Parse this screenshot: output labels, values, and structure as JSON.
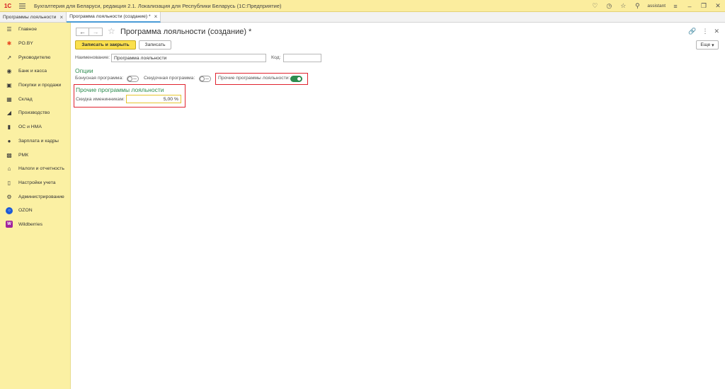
{
  "titlebar": {
    "logo": "1С",
    "title": "Бухгалтерия для Беларуси, редакция 2.1. Локализация для Республики Беларусь   (1С:Предприятие)",
    "user": "assistant"
  },
  "tabs": [
    {
      "label": "Программы лояльности",
      "active": false
    },
    {
      "label": "Программа лояльности (создание) *",
      "active": true
    }
  ],
  "sidebar": {
    "items": [
      {
        "label": "Главное",
        "icon": "menu-lines-icon"
      },
      {
        "label": "PO.BY",
        "icon": "asterisk-icon"
      },
      {
        "label": "Руководителю",
        "icon": "trend-chart-icon"
      },
      {
        "label": "Банк и касса",
        "icon": "coin-icon"
      },
      {
        "label": "Покупки и продажи",
        "icon": "cart-icon"
      },
      {
        "label": "Склад",
        "icon": "warehouse-icon"
      },
      {
        "label": "Производство",
        "icon": "factory-icon"
      },
      {
        "label": "ОС и НМА",
        "icon": "truck-icon"
      },
      {
        "label": "Зарплата и кадры",
        "icon": "person-icon"
      },
      {
        "label": "РМК",
        "icon": "register-icon"
      },
      {
        "label": "Налоги и отчетность",
        "icon": "taxes-icon"
      },
      {
        "label": "Настройки учета",
        "icon": "book-icon"
      },
      {
        "label": "Администрирование",
        "icon": "gear-icon"
      },
      {
        "label": "OZON",
        "icon": "ozon-logo-icon"
      },
      {
        "label": "Wildberries",
        "icon": "wildberries-logo-icon"
      }
    ]
  },
  "form": {
    "title": "Программа лояльности (создание) *",
    "save_close_label": "Записать и закрыть",
    "save_label": "Записать",
    "more_label": "Еще",
    "name_label": "Наименование:",
    "name_value": "Программа лояльности",
    "code_label": "Код:",
    "code_value": "",
    "options_title": "Опции",
    "bonus_label": "Бонусная программа:",
    "bonus_on": false,
    "discount_label": "Скидочная программа:",
    "discount_on": false,
    "other_label": "Прочие программы лояльности:",
    "other_on": true,
    "other_section_title": "Прочие программы лояльности",
    "birthday_label": "Скидка именинникам:",
    "birthday_value": "5,00 %"
  },
  "colors": {
    "accent_green": "#2d8c4f",
    "highlight_red": "#e0232f",
    "primary_button": "#fbe04d",
    "sidebar_bg": "#fbf0a3"
  }
}
